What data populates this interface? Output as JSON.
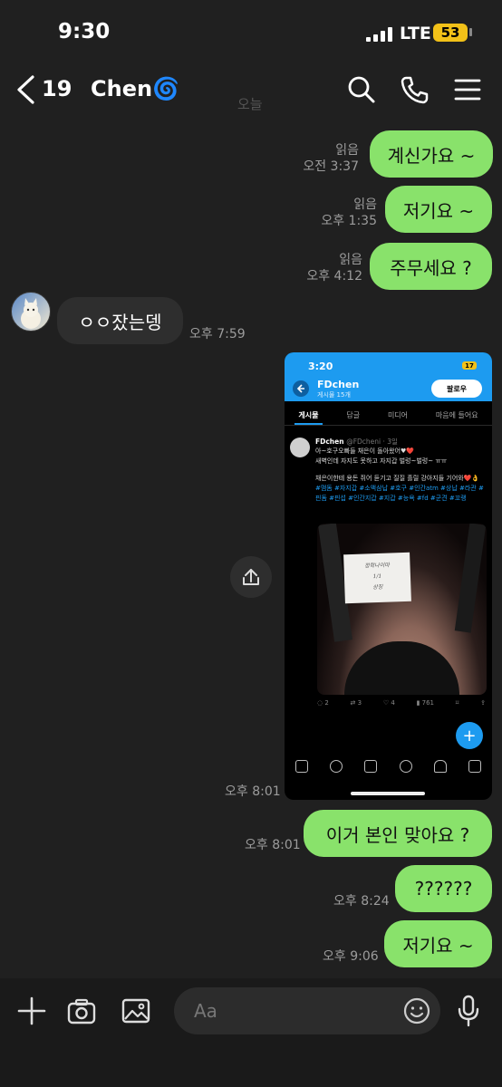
{
  "status_bar": {
    "time": "9:30",
    "network": "LTE",
    "battery": "53"
  },
  "header": {
    "back_count": "19",
    "title": "Chen🌀",
    "faded_date": "오늘"
  },
  "messages": [
    {
      "side": "me",
      "text": "계신가요 ~",
      "read": "읽음",
      "time": "오전 3:37"
    },
    {
      "side": "me",
      "text": "저기요 ~",
      "read": "읽음",
      "time": "오후 1:35"
    },
    {
      "side": "me",
      "text": "주무세요 ?",
      "read": "읽음",
      "time": "오후 4:12"
    },
    {
      "side": "other",
      "text": "ㅇㅇ잤는뎅",
      "time": "오후 7:59"
    },
    {
      "side": "me",
      "type": "image",
      "time": "오후 8:01"
    },
    {
      "side": "me",
      "text": "이거 본인 맞아요 ?",
      "time": "오후 8:01"
    },
    {
      "side": "me",
      "text": "??????",
      "time": "오후 8:24"
    },
    {
      "side": "me",
      "text": "저기요 ~",
      "time": "오후 9:06"
    }
  ],
  "shared_screenshot": {
    "time": "3:20",
    "battery": "17",
    "profile_name": "FDchen",
    "post_count": "게시물 15개",
    "follow_label": "팔로우",
    "tabs": [
      "게시물",
      "답글",
      "미디어",
      "마음에 들어요"
    ],
    "author": "FDchen",
    "handle": "@FDcheni · 3일",
    "post_line1": "아~호구오빠들 채은이 돌아왔어♥❤️",
    "post_line2": "새벽인데 자지도 못하고 자지갑 벌렁~벌렁~ ㅠㅠ",
    "post_line3": "채은이한테 용돈 쥐어 듣기고 질질 흘릴 강아지들 기어와❤️👌",
    "hashtags": "#맴돔 #자지갑 #소액삼납 #호구 #인간atm #상납 #라관 #핀돔 #핀섭 #인간지갑 #지갑 #능욕 #fd #군견 #꼬랭",
    "note_lines": [
      "정학나이마",
      "1/1",
      "상징"
    ],
    "stats": {
      "replies": "2",
      "reposts": "3",
      "likes": "4",
      "views": "761"
    },
    "fab": "+"
  },
  "composer": {
    "placeholder": "Aa"
  },
  "colors": {
    "my_bubble": "#89e26b",
    "other_bubble": "#2e2e2e",
    "background": "#202020",
    "twitter_blue": "#1d9bf0"
  }
}
